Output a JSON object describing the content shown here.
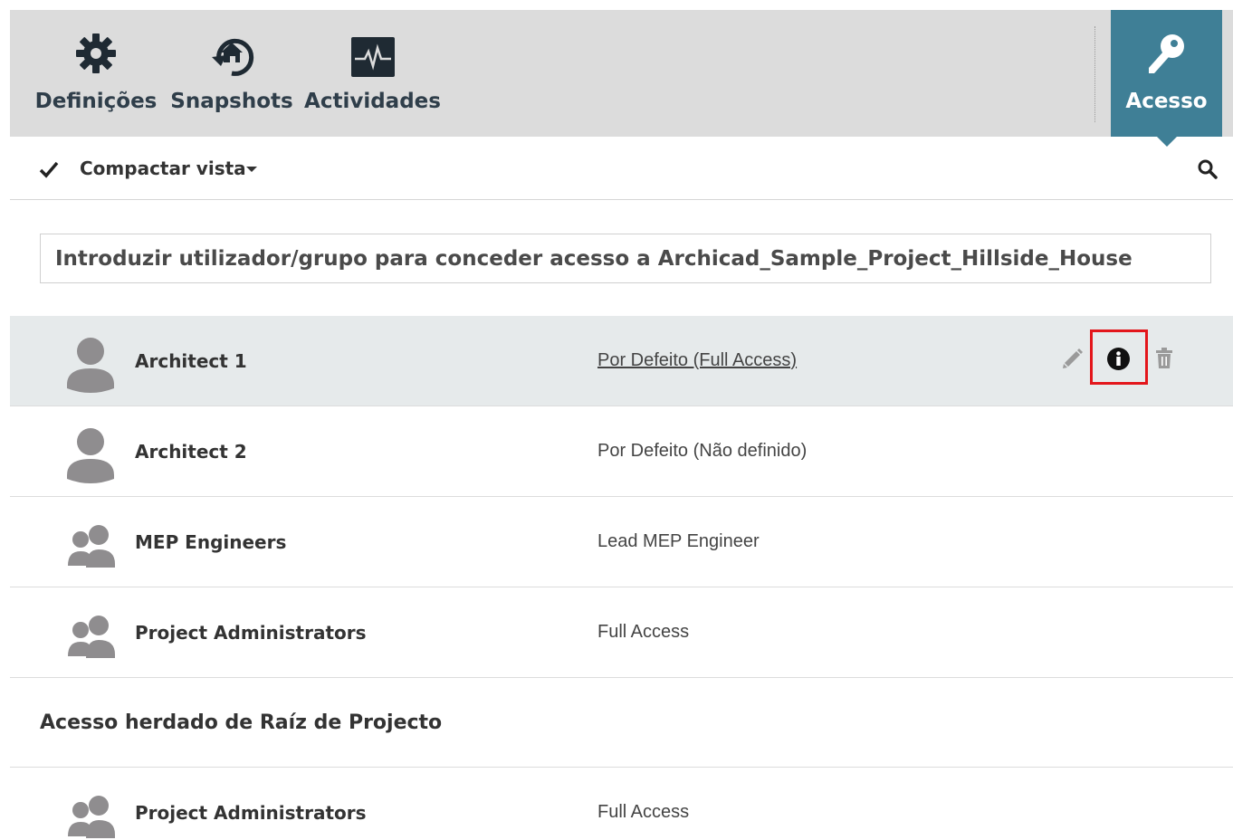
{
  "toolbar": {
    "items": [
      {
        "label": "Definições",
        "icon": "gear-icon"
      },
      {
        "label": "Snapshots",
        "icon": "snapshot-history-icon"
      },
      {
        "label": "Actividades",
        "icon": "activity-pulse-icon"
      }
    ],
    "active": {
      "label": "Acesso",
      "icon": "key-icon"
    }
  },
  "subbar": {
    "compact_label": "Compactar vista"
  },
  "grant_input": {
    "placeholder": "Introduzir utilizador/grupo para conceder acesso a Archicad_Sample_Project_Hillside_House"
  },
  "entries": [
    {
      "name": "Architect 1",
      "role": "Por Defeito  (Full Access)",
      "type": "user",
      "selected": true
    },
    {
      "name": "Architect 2",
      "role": "Por Defeito  (Não definido)",
      "type": "user"
    },
    {
      "name": "MEP Engineers",
      "role": "Lead MEP Engineer",
      "type": "group"
    },
    {
      "name": "Project Administrators",
      "role": "Full Access",
      "type": "group"
    }
  ],
  "inherited": {
    "heading": "Acesso herdado de Raíz de Projecto",
    "entries": [
      {
        "name": "Project Administrators",
        "role": "Full Access",
        "type": "group"
      }
    ]
  },
  "colors": {
    "toolbar_bg": "#dcdcdc",
    "active_tab": "#3f7f96",
    "selected_row": "#e6eaeb",
    "highlight_box": "#e3161b",
    "avatar": "#8f8d8f"
  }
}
